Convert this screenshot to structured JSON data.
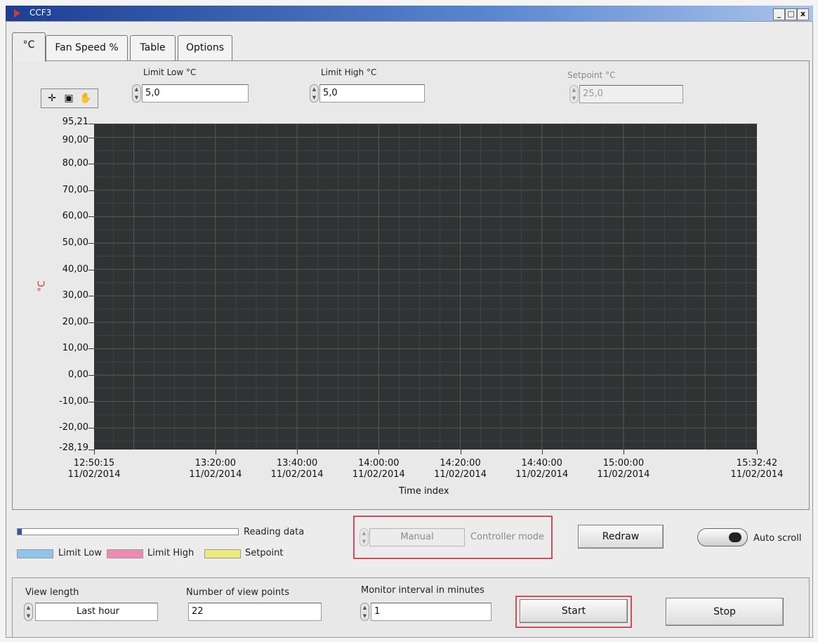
{
  "window": {
    "title": "CCF3",
    "min_label": "_",
    "max_label": "□",
    "close_label": "x"
  },
  "tabs": [
    {
      "label": "°C",
      "active": true
    },
    {
      "label": "Fan Speed %",
      "active": false
    },
    {
      "label": "Table",
      "active": false
    },
    {
      "label": "Options",
      "active": false
    }
  ],
  "controls": {
    "limit_low": {
      "label": "Limit Low °C",
      "value": "5,0"
    },
    "limit_high": {
      "label": "Limit High °C",
      "value": "5,0"
    },
    "setpoint": {
      "label": "Setpoint °C",
      "value": "25,0",
      "disabled": true
    }
  },
  "palette": {
    "icons": [
      "crosshair-icon",
      "zoom-icon",
      "pan-hand-icon"
    ]
  },
  "chart_data": {
    "type": "line",
    "title": "",
    "xlabel": "Time index",
    "ylabel": "°C",
    "ylim": [
      -28.19,
      95.21
    ],
    "y_ticks": [
      "95,21",
      "90,00",
      "80,00",
      "70,00",
      "60,00",
      "50,00",
      "40,00",
      "30,00",
      "20,00",
      "10,00",
      "0,00",
      "-10,00",
      "-20,00",
      "-28,19"
    ],
    "x_ticks": [
      {
        "time": "12:50:15",
        "date": "11/02/2014"
      },
      {
        "time": "13:20:00",
        "date": "11/02/2014"
      },
      {
        "time": "13:40:00",
        "date": "11/02/2014"
      },
      {
        "time": "14:00:00",
        "date": "11/02/2014"
      },
      {
        "time": "14:20:00",
        "date": "11/02/2014"
      },
      {
        "time": "14:40:00",
        "date": "11/02/2014"
      },
      {
        "time": "15:00:00",
        "date": "11/02/2014"
      },
      {
        "time": "15:32:42",
        "date": "11/02/2014"
      }
    ],
    "xlim": [
      "12:50:15",
      "15:32:42"
    ],
    "series": [],
    "grid": true,
    "plot_background": "#303234",
    "grid_color": "#5b6052"
  },
  "status": {
    "progress_label": "Reading data",
    "progress_fraction": 0.02,
    "legend": [
      {
        "label": "Limit Low",
        "color": "#8fc4ec"
      },
      {
        "label": "Limit High",
        "color": "#ef8ab4"
      },
      {
        "label": "Setpoint",
        "color": "#eeea7e"
      }
    ],
    "controller_mode_value": "Manual",
    "controller_mode_label": "Controller mode",
    "redraw_label": "Redraw",
    "auto_scroll_label": "Auto scroll"
  },
  "lower": {
    "view_length": {
      "label": "View length",
      "value": "Last hour"
    },
    "view_points": {
      "label": "Number of view points",
      "value": "22"
    },
    "monitor_interval": {
      "label": "Monitor interval in minutes",
      "value": "1"
    },
    "start_label": "Start",
    "stop_label": "Stop"
  },
  "colors": {
    "highlight": "#d24c5a",
    "title_bar": "#1d3e93"
  }
}
